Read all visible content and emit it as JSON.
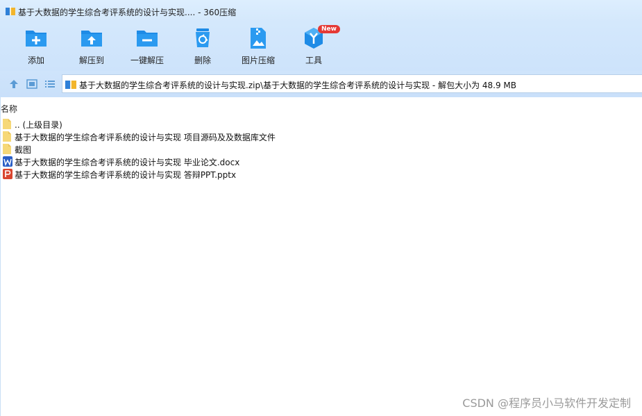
{
  "window": {
    "title": "基于大数据的学生综合考评系统的设计与实现.... - 360压缩"
  },
  "toolbar": {
    "add": "添加",
    "extract_to": "解压到",
    "one_click_extract": "一键解压",
    "delete": "删除",
    "image_compress": "图片压缩",
    "tools": "工具",
    "new_badge": "New"
  },
  "path_bar": {
    "path": "基于大数据的学生综合考评系统的设计与实现.zip\\基于大数据的学生综合考评系统的设计与实现 - 解包大小为 48.9 MB"
  },
  "file_list": {
    "column_name": "名称",
    "rows": [
      {
        "name": ".. (上级目录)",
        "icon": "folder-icon"
      },
      {
        "name": "基于大数据的学生综合考评系统的设计与实现 项目源码及及数据库文件",
        "icon": "folder-icon"
      },
      {
        "name": "截图",
        "icon": "folder-icon"
      },
      {
        "name": "基于大数据的学生综合考评系统的设计与实现 毕业论文.docx",
        "icon": "word-doc-icon"
      },
      {
        "name": "基于大数据的学生综合考评系统的设计与实现 答辩PPT.pptx",
        "icon": "ppt-icon"
      }
    ]
  },
  "watermark": "CSDN @程序员小马软件开发定制",
  "colors": {
    "accent_blue": "#1e8be6",
    "toolbar_bg": "#d4e8fc",
    "folder_yellow": "#f6d878",
    "word_blue": "#2b5fc6",
    "ppt_red": "#d9452f",
    "new_badge_red": "#e53935"
  }
}
